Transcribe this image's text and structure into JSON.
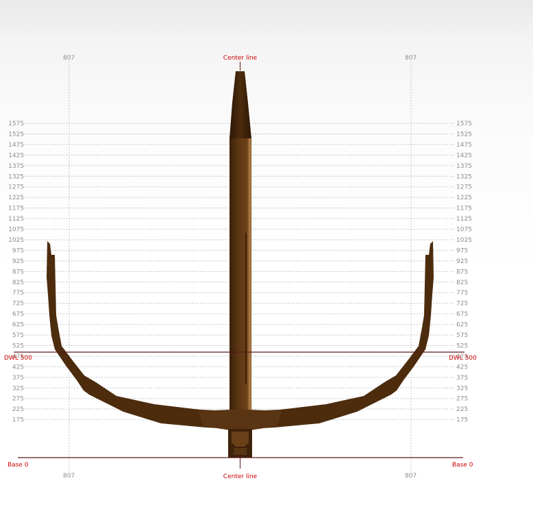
{
  "labels": {
    "center_line": "Center line",
    "dwl": "DWL 500",
    "base": "Base 0",
    "station": "807"
  },
  "frame_ticks": [
    "1575",
    "1525",
    "1475",
    "1425",
    "1375",
    "1325",
    "1275",
    "1225",
    "1175",
    "1125",
    "1075",
    "1025",
    "975",
    "925",
    "875",
    "825",
    "775",
    "725",
    "675",
    "625",
    "575",
    "525",
    "475",
    "425",
    "375",
    "325",
    "275",
    "225",
    "175"
  ],
  "colors": {
    "hull_dark": "#3e2209",
    "hull_mid": "#5a3513",
    "hull_light": "#8a5a2a",
    "reference_line": "#5a1a1a",
    "label_red": "#cc0000",
    "grid": "#c4c4c4"
  }
}
